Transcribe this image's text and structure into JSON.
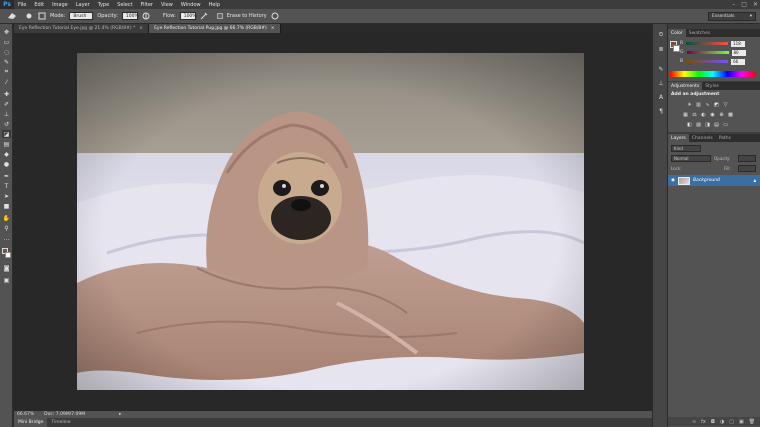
{
  "app": {
    "logo": "Ps"
  },
  "menu": [
    "File",
    "Edit",
    "Image",
    "Layer",
    "Type",
    "Select",
    "Filter",
    "View",
    "Window",
    "Help"
  ],
  "window_controls": [
    "–",
    "□",
    "✕"
  ],
  "options": {
    "mode_label": "Mode:",
    "mode_value": "Brush",
    "opacity_label": "Opacity:",
    "opacity_value": "100%",
    "flow_label": "Flow:",
    "flow_value": "100%",
    "erase_history_label": "Erase to History",
    "workspace": "Essentials"
  },
  "doc_tabs": [
    {
      "label": "Eye Reflection Tutorial Eye.jpg @ 21.4% (RGB/8#) *",
      "close": "×"
    },
    {
      "label": "Eye Reflection Tutorial Pug.jpg @ 66.7% (RGB/8#)",
      "close": "×"
    }
  ],
  "status": {
    "zoom": "66.67%",
    "doc": "Doc: 7.09M/7.09M"
  },
  "bridge_tabs": [
    "Mini Bridge",
    "Timeline"
  ],
  "color_panel": {
    "tabs": [
      "Color",
      "Swatches"
    ],
    "r": {
      "label": "R",
      "value": "118"
    },
    "g": {
      "label": "G",
      "value": "80"
    },
    "b": {
      "label": "B",
      "value": "66"
    },
    "foreground": "#764f42"
  },
  "adjustments_panel": {
    "tabs": [
      "Adjustments",
      "Styles"
    ],
    "heading": "Add an adjustment"
  },
  "layers_panel": {
    "tabs": [
      "Layers",
      "Channels",
      "Paths"
    ],
    "kind_label": "Kind",
    "blend_mode": "Normal",
    "opacity_label": "Opacity:",
    "lock_label": "Lock:",
    "fill_label": "Fill:",
    "layer_name": "Background"
  }
}
